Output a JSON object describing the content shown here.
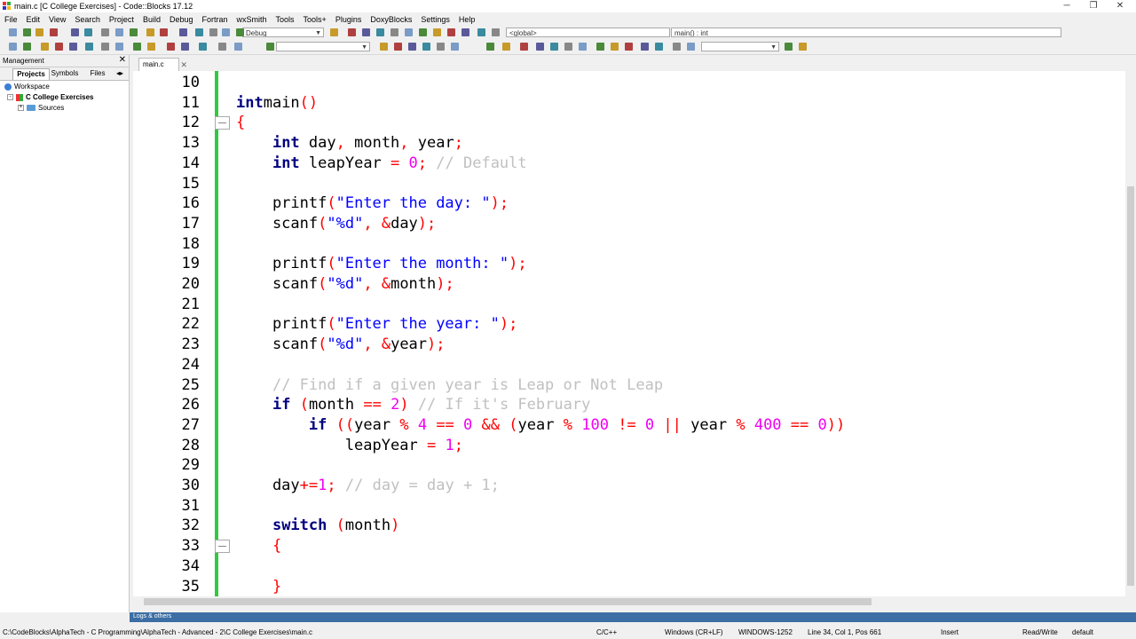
{
  "window": {
    "title": "main.c [C College Exercises] - Code::Blocks 17.12",
    "minimize": "─",
    "restore": "❐",
    "close": "✕"
  },
  "menu": [
    "File",
    "Edit",
    "View",
    "Search",
    "Project",
    "Build",
    "Debug",
    "Fortran",
    "wxSmith",
    "Tools",
    "Tools+",
    "Plugins",
    "DoxyBlocks",
    "Settings",
    "Help"
  ],
  "toolbar": {
    "build_target": "Debug",
    "scope": "<global>",
    "symbol": "main() : int"
  },
  "management": {
    "title": "Management",
    "close": "✕",
    "tabs": [
      "Projects",
      "Symbols",
      "Files"
    ],
    "tree": {
      "workspace": "Workspace",
      "project": "C College Exercises",
      "sources": "Sources"
    }
  },
  "editor": {
    "tab_label": "main.c",
    "tab_close": "✕",
    "lines": [
      {
        "n": "10",
        "t": []
      },
      {
        "n": "11",
        "t": [
          [
            "kw",
            "int"
          ],
          [
            "",
            "main"
          ],
          [
            "op",
            "()"
          ]
        ]
      },
      {
        "n": "12",
        "t": [
          [
            "op",
            "{"
          ]
        ]
      },
      {
        "n": "13",
        "t": [
          [
            "",
            "    "
          ],
          [
            "kw",
            "int"
          ],
          [
            "",
            " day"
          ],
          [
            "op",
            ","
          ],
          [
            "",
            " month"
          ],
          [
            "op",
            ","
          ],
          [
            "",
            " year"
          ],
          [
            "op",
            ";"
          ]
        ]
      },
      {
        "n": "14",
        "t": [
          [
            "",
            "    "
          ],
          [
            "kw",
            "int"
          ],
          [
            "",
            " leapYear "
          ],
          [
            "op",
            "="
          ],
          [
            "",
            " "
          ],
          [
            "num",
            "0"
          ],
          [
            "op",
            ";"
          ],
          [
            "",
            " "
          ],
          [
            "cm",
            "// Default"
          ]
        ]
      },
      {
        "n": "15",
        "t": []
      },
      {
        "n": "16",
        "t": [
          [
            "",
            "    printf"
          ],
          [
            "op",
            "("
          ],
          [
            "str",
            "\"Enter the day: \""
          ],
          [
            "op",
            ");"
          ]
        ]
      },
      {
        "n": "17",
        "t": [
          [
            "",
            "    scanf"
          ],
          [
            "op",
            "("
          ],
          [
            "str",
            "\"%d\""
          ],
          [
            "op",
            ","
          ],
          [
            "",
            " "
          ],
          [
            "op",
            "&"
          ],
          [
            "",
            "day"
          ],
          [
            "op",
            ");"
          ]
        ]
      },
      {
        "n": "18",
        "t": []
      },
      {
        "n": "19",
        "t": [
          [
            "",
            "    printf"
          ],
          [
            "op",
            "("
          ],
          [
            "str",
            "\"Enter the month: \""
          ],
          [
            "op",
            ");"
          ]
        ]
      },
      {
        "n": "20",
        "t": [
          [
            "",
            "    scanf"
          ],
          [
            "op",
            "("
          ],
          [
            "str",
            "\"%d\""
          ],
          [
            "op",
            ","
          ],
          [
            "",
            " "
          ],
          [
            "op",
            "&"
          ],
          [
            "",
            "month"
          ],
          [
            "op",
            ");"
          ]
        ]
      },
      {
        "n": "21",
        "t": []
      },
      {
        "n": "22",
        "t": [
          [
            "",
            "    printf"
          ],
          [
            "op",
            "("
          ],
          [
            "str",
            "\"Enter the year: \""
          ],
          [
            "op",
            ");"
          ]
        ]
      },
      {
        "n": "23",
        "t": [
          [
            "",
            "    scanf"
          ],
          [
            "op",
            "("
          ],
          [
            "str",
            "\"%d\""
          ],
          [
            "op",
            ","
          ],
          [
            "",
            " "
          ],
          [
            "op",
            "&"
          ],
          [
            "",
            "year"
          ],
          [
            "op",
            ");"
          ]
        ]
      },
      {
        "n": "24",
        "t": []
      },
      {
        "n": "25",
        "t": [
          [
            "",
            "    "
          ],
          [
            "cm",
            "// Find if a given year is Leap or Not Leap"
          ]
        ]
      },
      {
        "n": "26",
        "t": [
          [
            "",
            "    "
          ],
          [
            "kw",
            "if"
          ],
          [
            "",
            " "
          ],
          [
            "op",
            "("
          ],
          [
            "",
            "month "
          ],
          [
            "op",
            "=="
          ],
          [
            "",
            " "
          ],
          [
            "num",
            "2"
          ],
          [
            "op",
            ")"
          ],
          [
            "",
            " "
          ],
          [
            "cm",
            "// If it's February"
          ]
        ]
      },
      {
        "n": "27",
        "t": [
          [
            "",
            "        "
          ],
          [
            "kw",
            "if"
          ],
          [
            "",
            " "
          ],
          [
            "op",
            "("
          ],
          [
            "op",
            "("
          ],
          [
            "",
            "year "
          ],
          [
            "op",
            "%"
          ],
          [
            "",
            " "
          ],
          [
            "num",
            "4"
          ],
          [
            "",
            " "
          ],
          [
            "op",
            "=="
          ],
          [
            "",
            " "
          ],
          [
            "num",
            "0"
          ],
          [
            "",
            " "
          ],
          [
            "op",
            "&&"
          ],
          [
            "",
            " "
          ],
          [
            "op",
            "("
          ],
          [
            "",
            "year "
          ],
          [
            "op",
            "%"
          ],
          [
            "",
            " "
          ],
          [
            "num",
            "100"
          ],
          [
            "",
            " "
          ],
          [
            "op",
            "!="
          ],
          [
            "",
            " "
          ],
          [
            "num",
            "0"
          ],
          [
            "",
            " "
          ],
          [
            "op",
            "||"
          ],
          [
            "",
            " year "
          ],
          [
            "op",
            "%"
          ],
          [
            "",
            " "
          ],
          [
            "num",
            "400"
          ],
          [
            "",
            " "
          ],
          [
            "op",
            "=="
          ],
          [
            "",
            " "
          ],
          [
            "num",
            "0"
          ],
          [
            "op",
            "))"
          ]
        ]
      },
      {
        "n": "28",
        "t": [
          [
            "",
            "            leapYear "
          ],
          [
            "op",
            "="
          ],
          [
            "",
            " "
          ],
          [
            "num",
            "1"
          ],
          [
            "op",
            ";"
          ]
        ]
      },
      {
        "n": "29",
        "t": []
      },
      {
        "n": "30",
        "t": [
          [
            "",
            "    day"
          ],
          [
            "op",
            "+="
          ],
          [
            "num",
            "1"
          ],
          [
            "op",
            ";"
          ],
          [
            "",
            " "
          ],
          [
            "cm",
            "// day = day + 1;"
          ]
        ]
      },
      {
        "n": "31",
        "t": []
      },
      {
        "n": "32",
        "t": [
          [
            "",
            "    "
          ],
          [
            "kw",
            "switch"
          ],
          [
            "",
            " "
          ],
          [
            "op",
            "("
          ],
          [
            "",
            "month"
          ],
          [
            "op",
            ")"
          ]
        ]
      },
      {
        "n": "33",
        "t": [
          [
            "",
            "    "
          ],
          [
            "op",
            "{"
          ]
        ]
      },
      {
        "n": "34",
        "t": []
      },
      {
        "n": "35",
        "t": [
          [
            "",
            "    "
          ],
          [
            "op",
            "}"
          ]
        ]
      }
    ],
    "fold_lines": [
      "12",
      "33"
    ]
  },
  "logs_label": "Logs & others",
  "status": {
    "path": "C:\\CodeBlocks\\AlphaTech - C Programming\\AlphaTech - Advanced - 2\\C College Exercises\\main.c",
    "language": "C/C++",
    "eol": "Windows (CR+LF)",
    "encoding": "WINDOWS-1252",
    "position": "Line 34, Col 1, Pos 661",
    "mode": "Insert",
    "access": "Read/Write",
    "style": "default"
  },
  "colors": {
    "keyword": "#000080",
    "string": "#0000ff",
    "number": "#f000f0",
    "operator": "#ff0000",
    "comment": "#c0c0c0",
    "change_bar": "#31c940",
    "logs_bar": "#3c6ea5"
  }
}
